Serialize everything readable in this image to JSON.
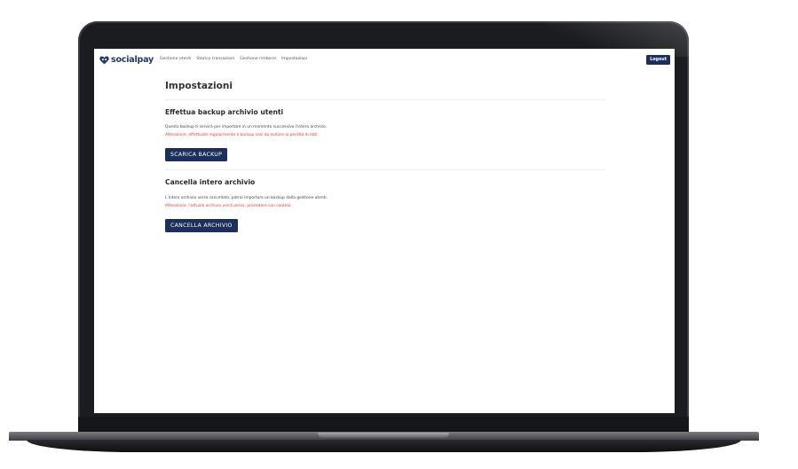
{
  "brand": {
    "name": "socialpay"
  },
  "nav": {
    "links": [
      "Gestione utenti",
      "Storico transazioni",
      "Gestione rimborsi",
      "Impostazioni"
    ],
    "logout_label": "Logout"
  },
  "page": {
    "title": "Impostazioni"
  },
  "backup": {
    "title": "Effettua backup archivio utenti",
    "description": "Questo backup ti servirà per importare in un momento successivo l'intero archivio.",
    "warning": "Attenzione, effettuate regolarmente il backup così da evitare la perdita di dati.",
    "button_label": "SCARICA BACKUP"
  },
  "delete": {
    "title": "Cancella intero archivio",
    "description": "L'intero archivio verrà cancellato, potrai importare un backup dalla gestione utenti.",
    "warning": "Attenzione, l'attuale archivio verrà perso, procedere con cautela.",
    "button_label": "CANCELLA ARCHIVIO"
  },
  "colors": {
    "primary": "#1e2f5b",
    "warning": "#e53935",
    "brand": "#1f3a6b"
  }
}
